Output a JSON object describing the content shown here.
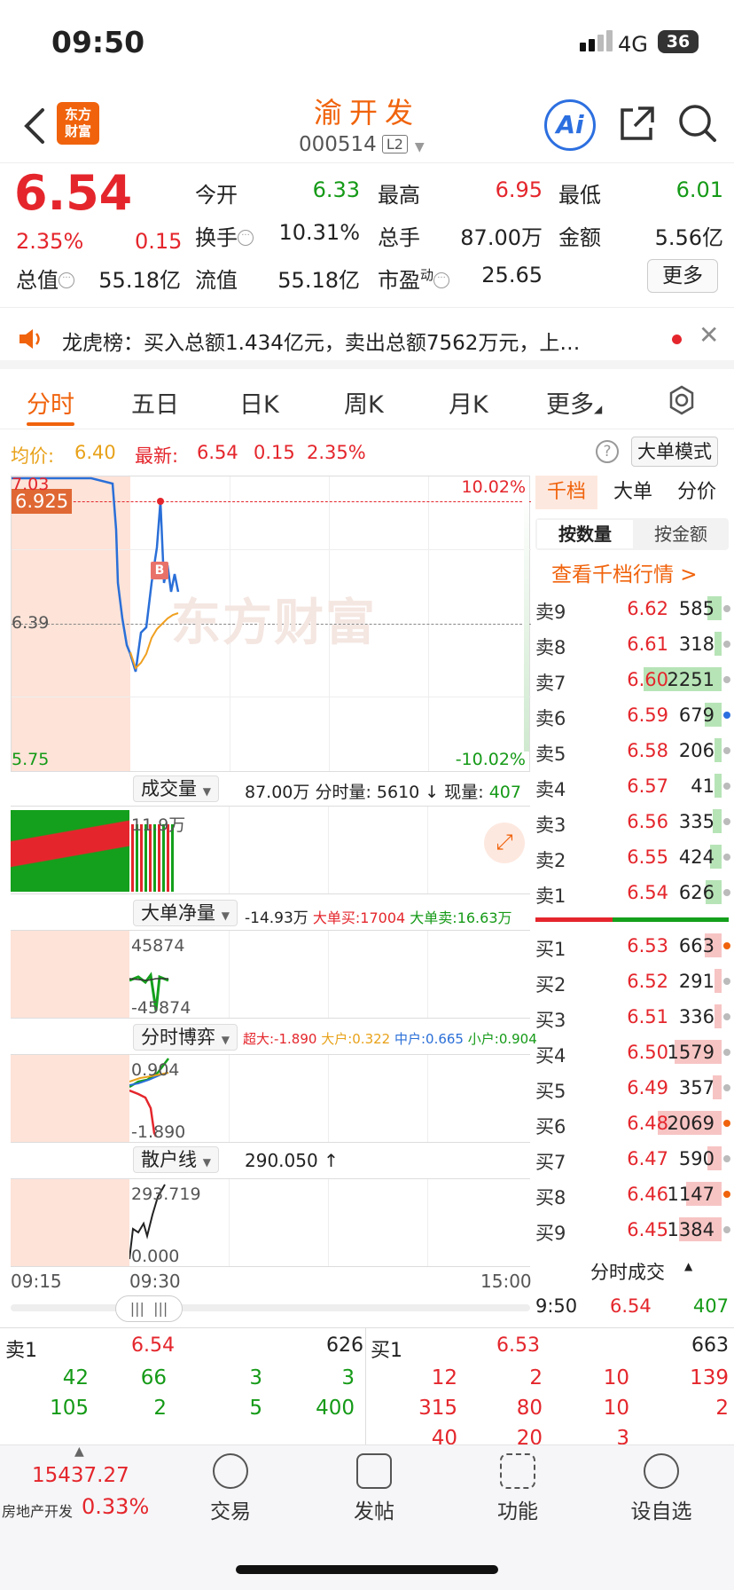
{
  "status": {
    "time": "09:50",
    "network": "4G",
    "battery": "36"
  },
  "header": {
    "logo": "东方\n财富",
    "logo_line1": "东方",
    "logo_line2": "财富",
    "title": "渝开发",
    "code": "000514",
    "l2": "L2",
    "ai": "Ai"
  },
  "quote": {
    "price": "6.54",
    "pct": "2.35%",
    "chg": "0.15",
    "open_label": "今开",
    "open": "6.33",
    "high_label": "最高",
    "high": "6.95",
    "low_label": "最低",
    "low": "6.01",
    "turnover_label": "换手",
    "turnover": "10.31%",
    "vol_label": "总手",
    "vol": "87.00万",
    "amount_label": "金额",
    "amount": "5.56亿",
    "mcap_label": "总值",
    "mcap": "55.18亿",
    "float_label": "流值",
    "float": "55.18亿",
    "pe_label": "市盈",
    "pe_sup": "动",
    "pe": "25.65",
    "more": "更多"
  },
  "notice": {
    "text": "龙虎榜：买入总额1.434亿元，卖出总额7562万元，上…"
  },
  "tabs": [
    "分时",
    "五日",
    "日K",
    "周K",
    "月K",
    "更多"
  ],
  "legend": {
    "avg_label": "均价:",
    "avg": "6.40",
    "new_label": "最新:",
    "new": "6.54",
    "chg": "0.15",
    "pct": "2.35%",
    "mode": "大单模式"
  },
  "main_chart": {
    "y_top": "7.03",
    "y_mid": "6.39",
    "y_bot": "5.75",
    "pct_top": "10.02%",
    "pct_bot": "-10.02%",
    "cross": "6.925",
    "marker": "B",
    "watermark": "东方财富"
  },
  "vol_panel": {
    "label": "成交量",
    "total": "87.00万",
    "fen_label": "分时量:",
    "fen": "5610",
    "now_label": "现量:",
    "now": "407",
    "ymax": "11.9万"
  },
  "big_panel": {
    "label": "大单净量",
    "net": "-14.93万",
    "buy": "大单买:17004",
    "sell": "大单卖:16.63万",
    "ymax": "45874",
    "ymin": "-45874"
  },
  "game_panel": {
    "label": "分时博弈",
    "super": "超大:-1.890",
    "big": "大户:0.322",
    "mid": "中户:0.665",
    "small": "小户:0.904",
    "ymax": "0.904",
    "ymin": "-1.890"
  },
  "retail_panel": {
    "label": "散户线",
    "val": "290.050",
    "ymax": "293.719",
    "ymin": "0.000"
  },
  "time_axis": {
    "t1": "09:15",
    "t2": "09:30",
    "t3": "15:00"
  },
  "side": {
    "tabs": [
      "千档",
      "大单",
      "分价"
    ],
    "sub": [
      "按数量",
      "按金额"
    ],
    "link": "查看千档行情 >",
    "asks": [
      {
        "l": "卖9",
        "p": "6.62",
        "v": "585",
        "w": 0.1,
        "dot": "#bbb"
      },
      {
        "l": "卖8",
        "p": "6.61",
        "v": "318",
        "w": 0.05,
        "dot": "#bbb"
      },
      {
        "l": "卖7",
        "p": "6.60",
        "v": "2251",
        "w": 0.55,
        "dot": "#bbb"
      },
      {
        "l": "卖6",
        "p": "6.59",
        "v": "679",
        "w": 0.12,
        "dot": "#2c6fe0"
      },
      {
        "l": "卖5",
        "p": "6.58",
        "v": "206",
        "w": 0.04,
        "dot": "#bbb"
      },
      {
        "l": "卖4",
        "p": "6.57",
        "v": "41",
        "w": 0.02,
        "dot": "#bbb"
      },
      {
        "l": "卖3",
        "p": "6.56",
        "v": "335",
        "w": 0.06,
        "dot": "#bbb"
      },
      {
        "l": "卖2",
        "p": "6.55",
        "v": "424",
        "w": 0.08,
        "dot": "#bbb"
      },
      {
        "l": "卖1",
        "p": "6.54",
        "v": "626",
        "w": 0.11,
        "dot": "#bbb"
      }
    ],
    "bids": [
      {
        "l": "买1",
        "p": "6.53",
        "v": "663",
        "w": 0.12,
        "dot": "#f0630c"
      },
      {
        "l": "买2",
        "p": "6.52",
        "v": "291",
        "w": 0.04,
        "dot": "#bbb"
      },
      {
        "l": "买3",
        "p": "6.51",
        "v": "336",
        "w": 0.05,
        "dot": "#bbb"
      },
      {
        "l": "买4",
        "p": "6.50",
        "v": "1579",
        "w": 0.33,
        "dot": "#bbb"
      },
      {
        "l": "买5",
        "p": "6.49",
        "v": "357",
        "w": 0.06,
        "dot": "#bbb"
      },
      {
        "l": "买6",
        "p": "6.48",
        "v": "2069",
        "w": 0.45,
        "dot": "#f0630c"
      },
      {
        "l": "买7",
        "p": "6.47",
        "v": "590",
        "w": 0.1,
        "dot": "#bbb"
      },
      {
        "l": "买8",
        "p": "6.46",
        "v": "1147",
        "w": 0.25,
        "dot": "#f0630c"
      },
      {
        "l": "买9",
        "p": "6.45",
        "v": "1384",
        "w": 0.3,
        "dot": "#bbb"
      }
    ],
    "deals_label": "分时成交",
    "deal": {
      "t": "9:50",
      "p": "6.54",
      "v": "407"
    }
  },
  "bottom": {
    "sell_label": "卖1",
    "sell_price": "6.54",
    "sell_vol": "626",
    "buy_label": "买1",
    "buy_price": "6.53",
    "buy_vol": "663",
    "sell_rows": [
      [
        "42",
        "66",
        "3",
        "3"
      ],
      [
        "105",
        "2",
        "5",
        "400"
      ]
    ],
    "buy_rows": [
      [
        "12",
        "2",
        "10",
        "139"
      ],
      [
        "315",
        "80",
        "10",
        "2"
      ],
      [
        "40",
        "20",
        "3",
        ""
      ]
    ]
  },
  "tabbar": {
    "index_value": "15437.27",
    "index_name": "房地产开发",
    "index_pct": "0.33%",
    "items": [
      "交易",
      "发帖",
      "功能",
      "设自选"
    ]
  }
}
